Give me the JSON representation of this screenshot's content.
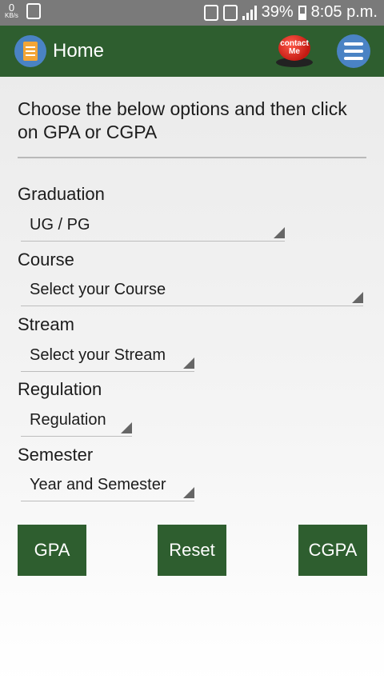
{
  "status_bar": {
    "speed_value": "0",
    "speed_unit": "KB/s",
    "battery": "39%",
    "time": "8:05 p.m."
  },
  "app_bar": {
    "title": "Home",
    "contact_line1": "contact",
    "contact_line2": "Me"
  },
  "intro": "Choose the below options and then click on GPA or CGPA",
  "fields": {
    "graduation": {
      "label": "Graduation",
      "value": "UG / PG"
    },
    "course": {
      "label": "Course",
      "value": "Select your Course"
    },
    "stream": {
      "label": "Stream",
      "value": "Select your Stream"
    },
    "regulation": {
      "label": "Regulation",
      "value": "Regulation"
    },
    "semester": {
      "label": "Semester",
      "value": "Year and Semester"
    }
  },
  "buttons": {
    "gpa": "GPA",
    "reset": "Reset",
    "cgpa": "CGPA"
  },
  "colors": {
    "app_bar": "#2e5e2f",
    "button": "#2e5e2f",
    "status_bar": "#7a7a7a",
    "accent_blue": "#4a83c4"
  },
  "icons": [
    "download-icon",
    "notification-icon",
    "sim-icon",
    "signal-icon",
    "battery-icon",
    "app-logo-icon",
    "contact-me-icon",
    "menu-icon",
    "dropdown-arrow-icon"
  ]
}
